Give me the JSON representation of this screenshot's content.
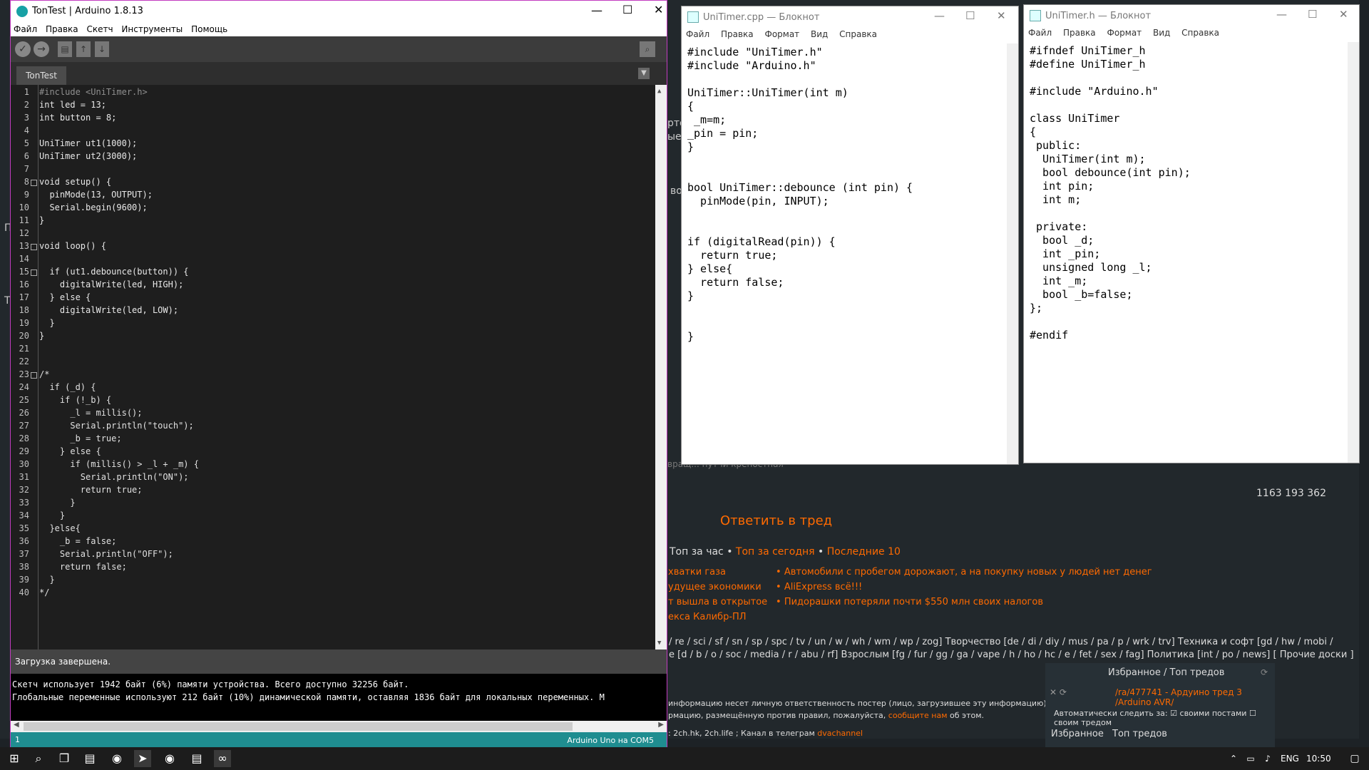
{
  "arduino": {
    "title": "TonTest | Arduino 1.8.13",
    "menu": [
      "Файл",
      "Правка",
      "Скетч",
      "Инструменты",
      "Помощь"
    ],
    "tab": "TonTest",
    "status": "Загрузка завершена.",
    "console": [
      "Скетч использует 1942 байт (6%) памяти устройства. Всего доступно 32256 байт.",
      "Глобальные переменные используют 212 байт (10%) динамической памяти, оставляя 1836 байт для локальных переменных. М"
    ],
    "line_indicator": "1",
    "board": "Arduino Uno на COM5",
    "code": [
      "#include <UniTimer.h>",
      "int led = 13;",
      "int button = 8;",
      "",
      "UniTimer ut1(1000);",
      "UniTimer ut2(3000);",
      "",
      "void setup() {",
      "  pinMode(13, OUTPUT);",
      "  Serial.begin(9600);",
      "}",
      "",
      "void loop() {",
      "",
      "  if (ut1.debounce(button)) {",
      "    digitalWrite(led, HIGH);",
      "  } else {",
      "    digitalWrite(led, LOW);",
      "  }",
      "}",
      "",
      "",
      "/*",
      "  if (_d) {",
      "    if (!_b) {",
      "      _l = millis();",
      "      Serial.println(\"touch\");",
      "      _b = true;",
      "    } else {",
      "      if (millis() > _l + _m) {",
      "        Serial.println(\"ON\");",
      "        return true;",
      "      }",
      "    }",
      "  }else{",
      "    _b = false;",
      "    Serial.println(\"OFF\");",
      "    return false;",
      "  }",
      "*/"
    ]
  },
  "notepad_cpp": {
    "title": "UniTimer.cpp — Блокнот",
    "menu": [
      "Файл",
      "Правка",
      "Формат",
      "Вид",
      "Справка"
    ],
    "text": "#include \"UniTimer.h\"\n#include \"Arduino.h\"\n\nUniTimer::UniTimer(int m)\n{\n _m=m;\n_pin = pin;\n}\n\n\nbool UniTimer::debounce (int pin) {\n  pinMode(pin, INPUT);\n\n\nif (digitalRead(pin)) {\n  return true;\n} else{\n  return false;\n}\n\n\n}"
  },
  "notepad_h": {
    "title": "UniTimer.h — Блокнот",
    "menu": [
      "Файл",
      "Правка",
      "Формат",
      "Вид",
      "Справка"
    ],
    "text": "#ifndef UniTimer_h\n#define UniTimer_h\n\n#include \"Arduino.h\"\n\nclass UniTimer\n{\n public:\n  UniTimer(int m);\n  bool debounce(int pin);\n  int pin;\n  int m;\n\n private:\n  bool _d;\n  int _pin;\n  unsigned long _l;\n  int _m;\n  bool _b=false;\n};\n\n#endif"
  },
  "background": {
    "reply": "Ответить в тред",
    "counters": "1163  193  362",
    "tops_prefix": "Топ за час •",
    "tops_today": "Топ за сегодня",
    "tops_last": "Последние 10",
    "news_left": [
      "хватки газа",
      "удущее экономики",
      "т вышла в открытое",
      "екса Калибр-ПЛ"
    ],
    "news_right": [
      "Автомобили с пробегом дорожают, а на покупку новых у людей нет денег",
      "AliExpress всё!!!",
      "Пидорашки потеряли почти $550 млн своих налогов"
    ],
    "boards_line1": "/ re / sci / sf / sn / sp / spc / tv / un / w / wh / wm / wp / zog] Творчество [de / di / diy / mus / pa / p / wrk / trv] Техника и софт [gd / hw / mobi /",
    "boards_line2": "e [d / b / o / soc / media / r / abu / rf] Взрослым [fg / fur / gg / ga / vape / h / ho / hc / e / fet / sex / fag] Политика [int / po / news] [ Прочие доски ]",
    "disclaimer1": "информацию несет личную ответственность постер (лицо, загрузившее эту информацию). Вс",
    "disclaimer2": "рмацию, размещённую против правил, пожалуйста,",
    "disclaimer_link": "сообщите нам",
    "disclaimer_end": "об этом.",
    "footer": ": 2ch.hk, 2ch.life ; Канал в телеграм",
    "footer_link": "dvachannel",
    "fav_title": "Избранное / Топ тредов",
    "fav_thread": "/ra/477741 - Ардуино тред 3 /Arduino AVR/",
    "fav_auto": "Автоматически следить за:",
    "fav_own_posts": "своими постами",
    "fav_own_thread": "своим тредом",
    "fav_tab1": "Избранное",
    "fav_tab2": "Топ тредов",
    "frag1": "рто",
    "frag2": "ые",
    "frag3": "во",
    "frag4": "П",
    "frag5": "Т",
    "frag6": "вращ... путчи крепостная"
  },
  "taskbar": {
    "lang": "ENG",
    "time": "10:50"
  }
}
